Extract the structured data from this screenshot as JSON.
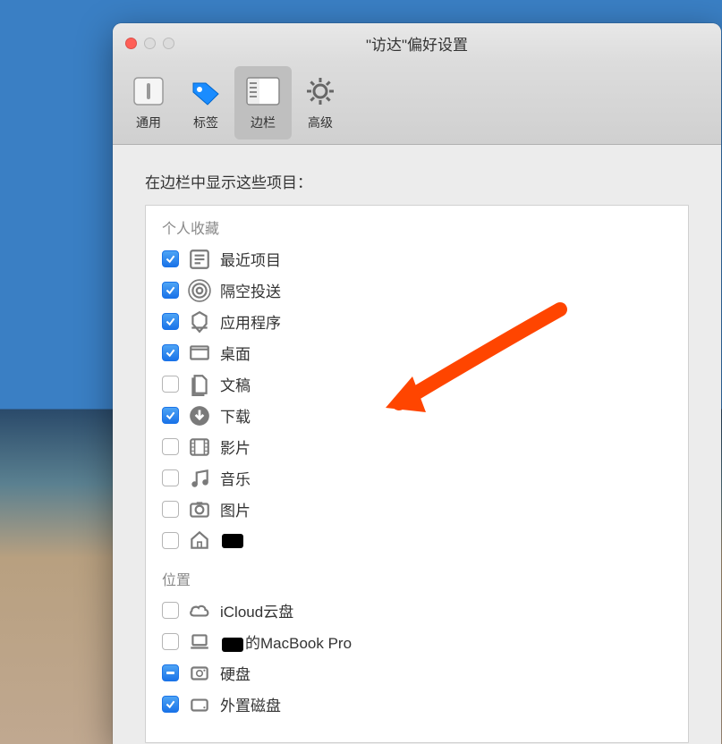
{
  "window": {
    "title": "\"访达\"偏好设置"
  },
  "toolbar": {
    "general": "通用",
    "tags": "标签",
    "sidebar": "边栏",
    "advanced": "高级"
  },
  "section": {
    "heading": "在边栏中显示这些项目："
  },
  "groups": {
    "favorites": {
      "label": "个人收藏",
      "items": [
        {
          "checked": true,
          "icon": "recents",
          "label": "最近项目"
        },
        {
          "checked": true,
          "icon": "airdrop",
          "label": "隔空投送"
        },
        {
          "checked": true,
          "icon": "apps",
          "label": "应用程序"
        },
        {
          "checked": true,
          "icon": "desktop",
          "label": "桌面"
        },
        {
          "checked": false,
          "icon": "documents",
          "label": "文稿"
        },
        {
          "checked": true,
          "icon": "downloads",
          "label": "下载"
        },
        {
          "checked": false,
          "icon": "movies",
          "label": "影片"
        },
        {
          "checked": false,
          "icon": "music",
          "label": "音乐"
        },
        {
          "checked": false,
          "icon": "pictures",
          "label": "图片"
        },
        {
          "checked": false,
          "icon": "home",
          "label": ""
        }
      ]
    },
    "locations": {
      "label": "位置",
      "items": [
        {
          "checked": false,
          "icon": "icloud",
          "label": "iCloud云盘"
        },
        {
          "checked": false,
          "icon": "laptop",
          "label": "的MacBook Pro",
          "obscured_prefix": true
        },
        {
          "checked": "mixed",
          "icon": "harddisk",
          "label": "硬盘"
        },
        {
          "checked": true,
          "icon": "external",
          "label": "外置磁盘"
        }
      ]
    }
  },
  "annotation": {
    "arrow_target": "documents-item"
  }
}
